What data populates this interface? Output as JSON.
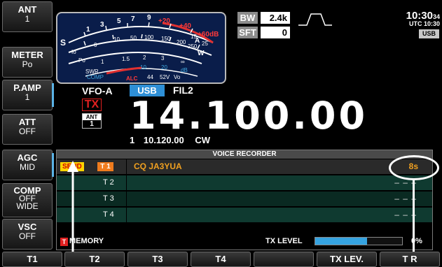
{
  "side_buttons": [
    {
      "label": "ANT",
      "value": "1",
      "highlight": false
    },
    {
      "label": "METER",
      "value": "Po",
      "highlight": false
    },
    {
      "label": "P.AMP",
      "value": "1",
      "highlight": true
    },
    {
      "label": "ATT",
      "value": "OFF",
      "highlight": false
    },
    {
      "label": "AGC",
      "value": "MID",
      "highlight": true
    },
    {
      "label": "COMP",
      "value": "OFF",
      "value2": "WIDE",
      "highlight": false
    },
    {
      "label": "VSC",
      "value": "OFF",
      "highlight": false
    }
  ],
  "meter": {
    "s_label": "S",
    "s_scale": [
      "1",
      "3",
      "5",
      "7",
      "9",
      "+20",
      "+40",
      "+60dB"
    ],
    "po_label": "Po",
    "po_scale": [
      "0",
      "10",
      "50",
      "100",
      "150",
      "200",
      "250"
    ],
    "amp_label": "A",
    "swr_label": "SWR",
    "swr_scale": [
      "1",
      "1.5",
      "2",
      "3",
      "∞"
    ],
    "w_label": "W",
    "comp_label": "COMP",
    "alc_label": "ALC",
    "comp_scale": [
      "10",
      "20",
      "dB"
    ],
    "vd_labels": [
      "44",
      "52V",
      "Vo"
    ],
    "id_scale": [
      "15",
      "25"
    ],
    "io_label": "Io"
  },
  "bw": {
    "label": "BW",
    "value": "2.4k"
  },
  "sft": {
    "label": "SFT",
    "value": "0"
  },
  "clock": {
    "time": "10:30",
    "seconds": "34",
    "utc": "UTC 10:30"
  },
  "usb_tag": "USB",
  "vfo": "VFO-A",
  "mode": "USB",
  "filter": "FIL2",
  "tx": "TX",
  "ant_badge": {
    "label": "ANT",
    "value": "1"
  },
  "frequency": "14.100.00",
  "sub_vfo": {
    "index": "1",
    "freq": "10.120.00",
    "mode": "CW"
  },
  "voice_recorder": {
    "title": "VOICE RECORDER",
    "rows": [
      {
        "status": "SEND",
        "tag": "T 1",
        "text": "CQ  JA3YUA",
        "time": "8s"
      },
      {
        "label": "T 2",
        "time": "– – –"
      },
      {
        "label": "T 3",
        "time": "– – –"
      },
      {
        "label": "T 4",
        "time": "– – –"
      }
    ],
    "memory_tag": "T",
    "memory_label": "MEMORY",
    "tx_level_label": "TX LEVEL",
    "tx_level_value": "0%",
    "tx_level_fill": 0.6
  },
  "function_keys": [
    "T1",
    "T2",
    "T3",
    "T4",
    "",
    "TX LEV.",
    "T R"
  ],
  "colors": {
    "accent_blue": "#5bb3e6",
    "send_yellow": "#ffd400",
    "tag_orange": "#f07c1e",
    "tx_red": "#e02020",
    "row_green": "#0f3a30"
  }
}
